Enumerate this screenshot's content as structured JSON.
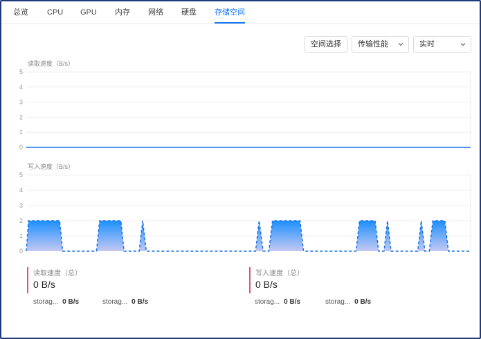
{
  "tabs": [
    {
      "label": "总览",
      "active": false
    },
    {
      "label": "CPU",
      "active": false
    },
    {
      "label": "GPU",
      "active": false
    },
    {
      "label": "内存",
      "active": false
    },
    {
      "label": "网络",
      "active": false
    },
    {
      "label": "硬盘",
      "active": false
    },
    {
      "label": "存储空间",
      "active": true
    }
  ],
  "toolbar": {
    "space_button": "空间选择",
    "metric_select": "传输性能",
    "range_select": "实时"
  },
  "colors": {
    "accent": "#1677ff",
    "series_line": "#1a73e8",
    "fill_top": "#1e90ff",
    "fill_bottom": "#c4c8f2",
    "stat_bar": "#e0528c",
    "frame": "#1f3a7a"
  },
  "chart_data": [
    {
      "type": "area",
      "title": "读取速度（B/s）",
      "ylim": [
        0,
        5
      ],
      "yticks": [
        "0",
        "1",
        "2",
        "3",
        "4",
        "5"
      ],
      "grid": true,
      "series": [
        {
          "values": [
            [
              0,
              0
            ],
            [
              100,
              0
            ]
          ]
        }
      ]
    },
    {
      "type": "area",
      "title": "写入速度（B/s）",
      "ylim": [
        0,
        5
      ],
      "yticks": [
        "0",
        "1",
        "2",
        "3",
        "4",
        "5"
      ],
      "grid": true,
      "series": [
        {
          "values": [
            [
              0,
              0
            ],
            [
              0.5,
              2
            ],
            [
              7.5,
              2
            ],
            [
              8.2,
              0
            ],
            [
              15.8,
              0
            ],
            [
              16.5,
              2
            ],
            [
              21.3,
              2
            ],
            [
              22,
              0
            ],
            [
              25.4,
              0
            ],
            [
              26.2,
              2
            ],
            [
              27,
              0
            ],
            [
              51.6,
              0
            ],
            [
              52.4,
              2
            ],
            [
              53.3,
              0
            ],
            [
              54.6,
              0
            ],
            [
              55.4,
              2
            ],
            [
              61.6,
              2
            ],
            [
              62.4,
              0
            ],
            [
              74.2,
              0
            ],
            [
              75,
              2
            ],
            [
              78.5,
              2
            ],
            [
              79.3,
              0
            ],
            [
              80.5,
              0
            ],
            [
              81.3,
              2
            ],
            [
              82.1,
              0
            ],
            [
              88.1,
              0
            ],
            [
              88.9,
              2
            ],
            [
              89.7,
              0
            ],
            [
              90.7,
              0
            ],
            [
              91.5,
              2
            ],
            [
              94.2,
              2
            ],
            [
              95,
              0
            ],
            [
              100,
              0
            ]
          ]
        }
      ]
    }
  ],
  "stats": [
    {
      "label": "读取速度（总）",
      "value": "0 B/s",
      "items": [
        {
          "name": "storag...",
          "value": "0 B/s"
        },
        {
          "name": "storag...",
          "value": "0 B/s"
        }
      ]
    },
    {
      "label": "写入速度（总）",
      "value": "0 B/s",
      "items": [
        {
          "name": "storag...",
          "value": "0 B/s"
        },
        {
          "name": "storag...",
          "value": "0 B/s"
        }
      ]
    }
  ]
}
